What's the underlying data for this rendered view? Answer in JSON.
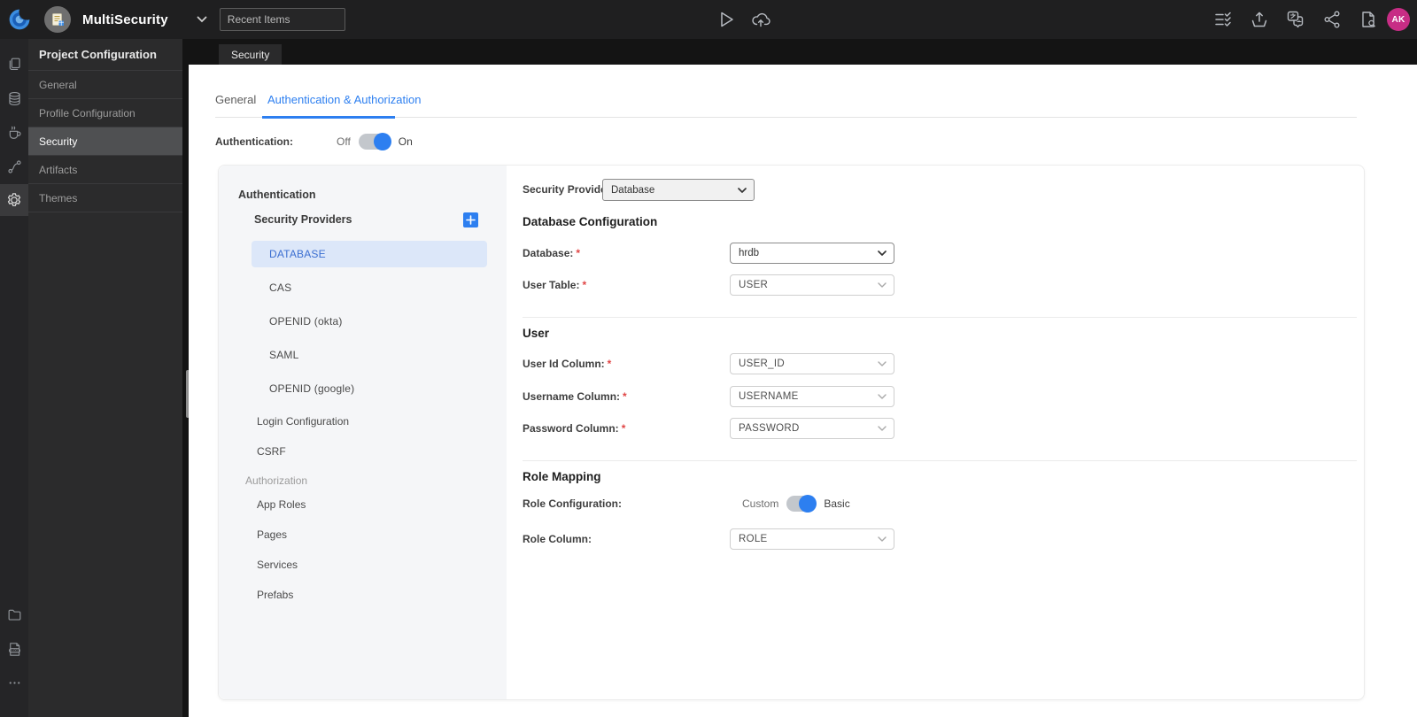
{
  "colors": {
    "accent": "#2d7ff0",
    "avatar_bg": "#c72d85",
    "selected_provider_bg": "#dce7f9",
    "selected_provider_text": "#3c6fd1",
    "topbar_bg": "#1f1f20",
    "sidebar_bg": "#2b2b2c"
  },
  "topbar": {
    "project_name": "MultiSecurity",
    "recent_items_placeholder": "Recent Items",
    "avatar_initials": "AK",
    "icons": [
      "wavemaker-logo",
      "project-icon",
      "chevron-down-icon",
      "run-icon",
      "cloud-upload-icon",
      "checklist-icon",
      "publish-icon",
      "translate-icon",
      "share-icon",
      "file-preview-icon"
    ]
  },
  "rail": {
    "icons": [
      "pages-icon",
      "database-icon",
      "java-icon",
      "api-icon",
      "settings-icon",
      "folder-icon",
      "log-icon",
      "more-icon"
    ],
    "active": "settings-icon"
  },
  "sidebar": {
    "title": "Project Configuration",
    "items": [
      "General",
      "Profile Configuration",
      "Security",
      "Artifacts",
      "Themes"
    ],
    "active_item": "Security"
  },
  "window_tab": "Security",
  "main": {
    "tabs": [
      "General",
      "Authentication & Authorization"
    ],
    "active_tab": "Authentication & Authorization",
    "authentication": {
      "label": "Authentication:",
      "off": "Off",
      "on": "On",
      "state": "On"
    },
    "nav": {
      "auth_header": "Authentication",
      "providers_label": "Security Providers",
      "providers": [
        "DATABASE",
        "CAS",
        "OPENID (okta)",
        "SAML",
        "OPENID (google)"
      ],
      "selected_provider": "DATABASE",
      "items": [
        "Login Configuration",
        "CSRF"
      ],
      "authz_header": "Authorization",
      "authz_items": [
        "App Roles",
        "Pages",
        "Services",
        "Prefabs"
      ]
    },
    "form": {
      "security_provider": {
        "label": "Security Provider",
        "value": "Database"
      },
      "database_configuration_heading": "Database Configuration",
      "database": {
        "label": "Database:",
        "required": "*",
        "value": "hrdb"
      },
      "user_table": {
        "label": "User Table:",
        "required": "*",
        "value": "USER"
      },
      "user_heading": "User",
      "user_id_column": {
        "label": "User Id Column:",
        "required": "*",
        "value": "USER_ID"
      },
      "username_column": {
        "label": "Username Column:",
        "required": "*",
        "value": "USERNAME"
      },
      "password_column": {
        "label": "Password Column:",
        "required": "*",
        "value": "PASSWORD"
      },
      "role_mapping_heading": "Role Mapping",
      "role_configuration": {
        "label": "Role Configuration:",
        "custom": "Custom",
        "basic": "Basic",
        "state": "Basic"
      },
      "role_column": {
        "label": "Role Column:",
        "value": "ROLE"
      }
    }
  }
}
